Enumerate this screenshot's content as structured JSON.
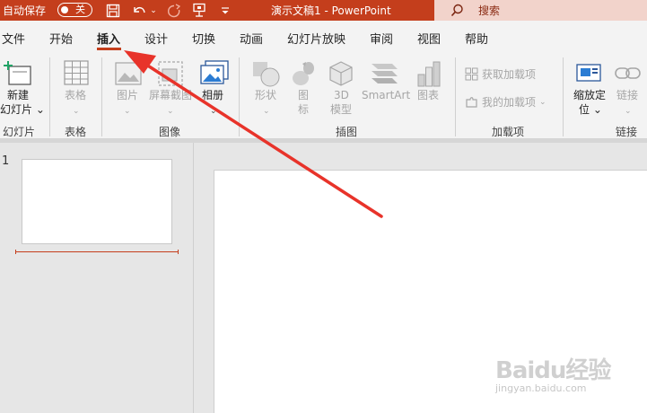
{
  "titlebar": {
    "autosave_label": "自动保存",
    "autosave_state": "关",
    "doc_title": "演示文稿1  -  PowerPoint",
    "search_label": "搜索",
    "bg_color": "#c43e1c"
  },
  "menu": {
    "tabs": [
      "文件",
      "开始",
      "插入",
      "设计",
      "切换",
      "动画",
      "幻灯片放映",
      "审阅",
      "视图",
      "帮助"
    ],
    "active_tab": "插入"
  },
  "ribbon": {
    "new_slide": {
      "line1": "新建",
      "line2": "幻灯片 ⌄"
    },
    "table": {
      "label": "表格"
    },
    "pictures": {
      "label": "图片"
    },
    "screenshot": {
      "label": "屏幕截图"
    },
    "album": {
      "label": "相册"
    },
    "shapes": {
      "label": "形状"
    },
    "icons": {
      "line1": "图",
      "line2": "标"
    },
    "model3d": {
      "line1": "3D",
      "line2": "模型"
    },
    "smartart": {
      "label": "SmartArt"
    },
    "chart": {
      "label": "图表"
    },
    "get_addins": {
      "label": "获取加载项"
    },
    "my_addins": {
      "label": "我的加载项"
    },
    "zoom": {
      "line1": "缩放定",
      "line2": "位 ⌄"
    },
    "link": {
      "label": "链接"
    },
    "groups": {
      "slides": "幻灯片",
      "tables": "表格",
      "images": "图像",
      "illustrations": "插图",
      "addins": "加载项",
      "links": "链接"
    }
  },
  "slides_pane": {
    "slide_number": "1"
  },
  "watermark": {
    "brand": "Baidu经验",
    "url": "jingyan.baidu.com"
  },
  "colors": {
    "accent": "#c43e1c",
    "annotation_arrow": "#e8332a",
    "ribbon_bg": "#f3f3f3"
  }
}
